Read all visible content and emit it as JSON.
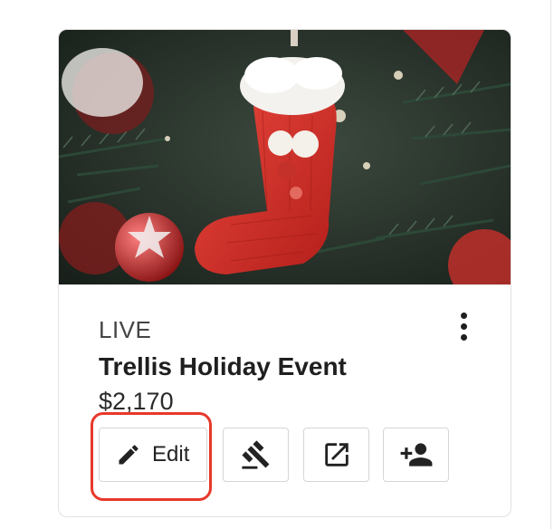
{
  "card": {
    "status": "LIVE",
    "title": "Trellis Holiday Event",
    "price": "$2,170",
    "image_subject": "Christmas stocking on a decorated tree",
    "actions": {
      "edit_label": "Edit",
      "edit_icon": "pencil-icon",
      "bid_icon": "gavel-icon",
      "open_icon": "open-in-new-icon",
      "add_icon": "person-add-icon",
      "more_icon": "more-vertical-icon"
    }
  },
  "colors": {
    "highlight": "#e8382b",
    "text": "#1f1f1f",
    "border": "#d6d6d6"
  }
}
